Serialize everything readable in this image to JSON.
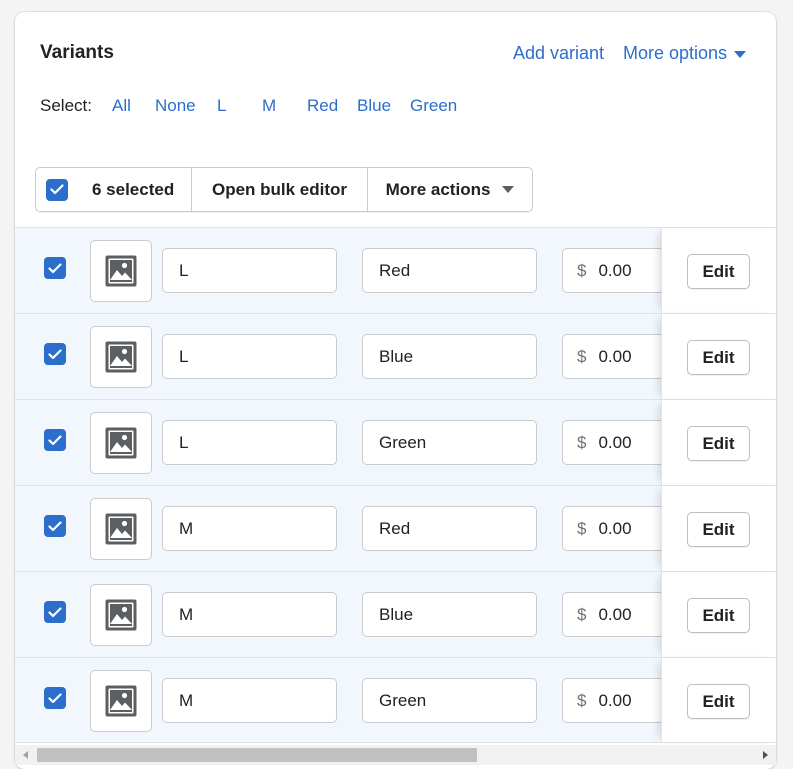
{
  "header": {
    "title": "Variants",
    "add_variant_label": "Add variant",
    "more_options_label": "More options"
  },
  "select": {
    "label": "Select:",
    "options": [
      "All",
      "None",
      "L",
      "M",
      "Red",
      "Blue",
      "Green"
    ]
  },
  "bulk": {
    "selected_label": "6 selected",
    "open_bulk_editor_label": "Open bulk editor",
    "more_actions_label": "More actions"
  },
  "variants": [
    {
      "size": "L",
      "color": "Red",
      "currency": "$",
      "price": "0.00",
      "edit_label": "Edit",
      "checked": true
    },
    {
      "size": "L",
      "color": "Blue",
      "currency": "$",
      "price": "0.00",
      "edit_label": "Edit",
      "checked": true
    },
    {
      "size": "L",
      "color": "Green",
      "currency": "$",
      "price": "0.00",
      "edit_label": "Edit",
      "checked": true
    },
    {
      "size": "M",
      "color": "Red",
      "currency": "$",
      "price": "0.00",
      "edit_label": "Edit",
      "checked": true
    },
    {
      "size": "M",
      "color": "Blue",
      "currency": "$",
      "price": "0.00",
      "edit_label": "Edit",
      "checked": true
    },
    {
      "size": "M",
      "color": "Green",
      "currency": "$",
      "price": "0.00",
      "edit_label": "Edit",
      "checked": true
    }
  ],
  "icons": {
    "checkbox": "checkmark-icon",
    "thumbnail": "image-placeholder-icon",
    "more_options": "caret-down-icon",
    "more_actions": "caret-down-icon"
  },
  "colors": {
    "accent": "#2c6ecb",
    "selected_row_bg": "#f2f7fe"
  }
}
